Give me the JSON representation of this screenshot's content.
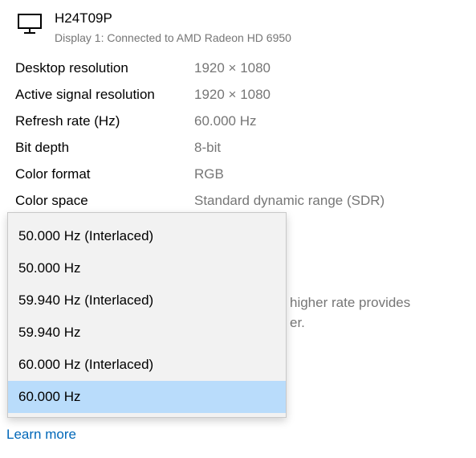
{
  "display": {
    "name": "H24T09P",
    "subtitle": "Display 1: Connected to AMD Radeon HD 6950",
    "icon": "monitor-icon"
  },
  "info": {
    "rows": [
      {
        "label": "Desktop resolution",
        "value": "1920 × 1080"
      },
      {
        "label": "Active signal resolution",
        "value": "1920 × 1080"
      },
      {
        "label": "Refresh rate (Hz)",
        "value": "60.000 Hz"
      },
      {
        "label": "Bit depth",
        "value": "8-bit"
      },
      {
        "label": "Color format",
        "value": "RGB"
      },
      {
        "label": "Color space",
        "value": "Standard dynamic range (SDR)"
      }
    ]
  },
  "background_text": {
    "line1": "higher rate provides",
    "line2": "er."
  },
  "dropdown": {
    "options": [
      "50.000 Hz (Interlaced)",
      "50.000 Hz",
      "59.940 Hz (Interlaced)",
      "59.940 Hz",
      "60.000 Hz (Interlaced)",
      "60.000 Hz"
    ],
    "selected": "60.000 Hz"
  },
  "links": {
    "learn_more": "Learn more"
  },
  "colors": {
    "selected_highlight": "#b9dcfb",
    "link": "#0067b8",
    "secondary_text": "#767676"
  }
}
